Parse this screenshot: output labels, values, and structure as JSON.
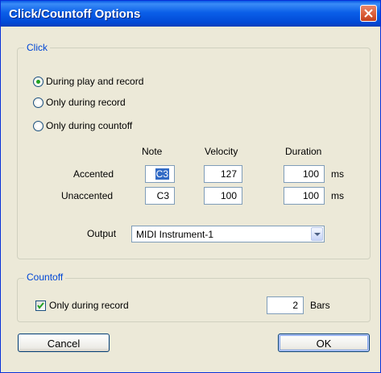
{
  "window": {
    "title": "Click/Countoff Options"
  },
  "click_group": {
    "legend": "Click",
    "options": [
      {
        "label": "During play and record",
        "selected": true
      },
      {
        "label": "Only during record",
        "selected": false
      },
      {
        "label": "Only during countoff",
        "selected": false
      }
    ],
    "columns": {
      "note": "Note",
      "velocity": "Velocity",
      "duration": "Duration"
    },
    "rows": [
      {
        "label": "Accented",
        "note": "C3",
        "velocity": "127",
        "duration": "100",
        "unit": "ms"
      },
      {
        "label": "Unaccented",
        "note": "C3",
        "velocity": "100",
        "duration": "100",
        "unit": "ms"
      }
    ],
    "output": {
      "label": "Output",
      "value": "MIDI Instrument-1"
    }
  },
  "countoff_group": {
    "legend": "Countoff",
    "checkbox": {
      "label": "Only during record",
      "checked": true
    },
    "bars": {
      "value": "2",
      "unit": "Bars"
    }
  },
  "buttons": {
    "cancel": "Cancel",
    "ok": "OK"
  },
  "colors": {
    "title_bar": "#0a5ae6",
    "group_legend": "#0046d5",
    "dialog_face": "#ece9d8",
    "close_button": "#d95b36"
  }
}
